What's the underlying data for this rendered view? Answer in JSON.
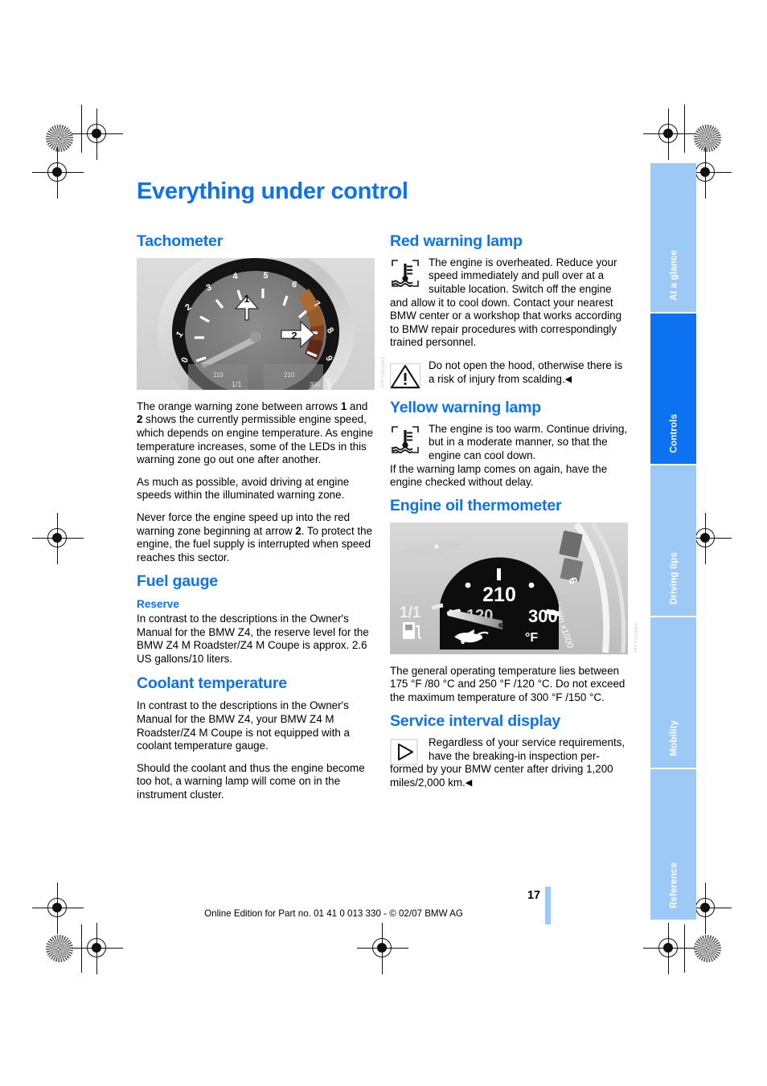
{
  "page": {
    "title": "Everything under control",
    "number": "17",
    "footer": "Online Edition for Part no. 01 41 0 013 330 - © 02/07 BMW AG"
  },
  "colors": {
    "heading_blue": "#0d72f2",
    "tab_inactive": "#9dc9f7",
    "tab_active": "#0d72f2"
  },
  "left_column": {
    "tachometer": {
      "heading": "Tachometer",
      "figure": {
        "name": "tachometer-photo",
        "credit": "Z4MTAC1.eps",
        "callout_1": "1",
        "callout_2": "2",
        "dial_numbers": [
          "0",
          "1",
          "2",
          "3",
          "4",
          "5",
          "6",
          "7",
          "8",
          "9"
        ],
        "scale_label": "1/min x1000",
        "inset_left": "1/1",
        "inset_right_low": "110",
        "inset_right_high": "210",
        "inset_right_max": "300"
      },
      "paragraphs": [
        "The orange warning zone between arrows 1 and 2 shows the currently permissible engine speed, which depends on engine temperature. As engine temperature increases, some of the LEDs in this warning zone go out one after another.",
        "As much as possible, avoid driving at engine speeds within the illuminated warning zone.",
        "Never force the engine speed up into the red warning zone beginning at arrow 2. To protect the engine, the fuel supply is interrupted when speed reaches this sector."
      ]
    },
    "fuel_gauge": {
      "heading": "Fuel gauge",
      "subheading": "Reserve",
      "paragraph": "In contrast to the descriptions in the Owner's Manual for the BMW Z4, the reserve level for the BMW Z4 M Roadster/Z4 M Coupe is approx. 2.6 US gallons/10 liters."
    },
    "coolant_temperature": {
      "heading": "Coolant temperature",
      "paragraphs": [
        "In contrast to the descriptions in the Owner's Manual for the BMW Z4, your BMW Z4 M Roadster/Z4 M Coupe is not equipped with a coolant temperature gauge.",
        "Should the coolant and thus the engine become too hot, a warning lamp will come on in the instrument cluster."
      ]
    }
  },
  "right_column": {
    "red_warning_lamp": {
      "heading": "Red warning lamp",
      "icon": "coolant-temperature-warning-icon",
      "note_indented": "The engine is overheated. Reduce your speed immediately and pull over at a suitable location. Switch off the engine",
      "note_rest": "and allow it to cool down. Contact your nearest BMW center or a workshop that works according to BMW repair procedures with correspondingly trained personnel.",
      "warning": {
        "icon": "warning-triangle-icon",
        "text": "Do not open the hood, otherwise there is a risk of injury from scalding.",
        "end_marker": "◀"
      }
    },
    "yellow_warning_lamp": {
      "heading": "Yellow warning lamp",
      "icon": "coolant-temperature-warning-icon",
      "note_indented": "The engine is too warm. Continue driving, but in a moderate manner, so that the engine can cool down.",
      "note_rest": "If the warning lamp comes on again, have the engine checked without delay."
    },
    "engine_oil_thermometer": {
      "heading": "Engine oil thermometer",
      "figure": {
        "name": "engine-oil-thermometer-photo",
        "credit": "Z4MOIL1.eps",
        "dial_mid": "210",
        "dial_low": "120",
        "dial_high": "300",
        "unit": "°F",
        "fuel_label": "1/1",
        "tach_label": "1/min x1000",
        "tach_number": "6",
        "oil_can_icon": "oil-can-icon",
        "fuel_pump_icon": "fuel-pump-icon"
      },
      "paragraph": "The general operating temperature lies between 175 °F /80 °C and 250 °F /120 °C. Do not exceed the maximum temperature of 300 °F /150 °C."
    },
    "service_interval_display": {
      "heading": "Service interval display",
      "note": {
        "icon": "play-triangle-note-icon",
        "text_indented": "Regardless of your service requirements, have the breaking-in inspection per-",
        "text_rest": "formed by your BMW center after driving 1,200 miles/2,000 km.",
        "end_marker": "◀"
      }
    }
  },
  "tabs": [
    {
      "label": "At a glance",
      "active": false
    },
    {
      "label": "Controls",
      "active": true
    },
    {
      "label": "Driving tips",
      "active": false
    },
    {
      "label": "Mobility",
      "active": false
    },
    {
      "label": "Reference",
      "active": false
    }
  ]
}
